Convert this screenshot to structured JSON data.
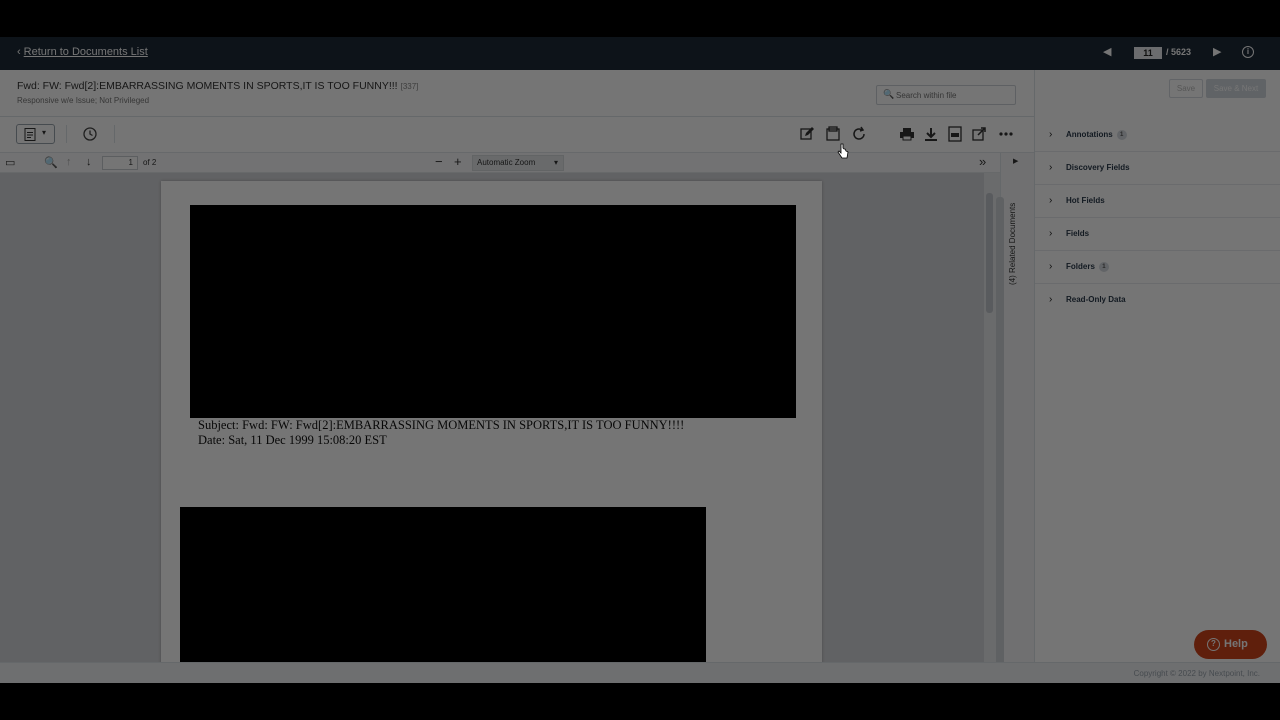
{
  "nav": {
    "back_label": "Return to Documents List",
    "current_page": "11",
    "total_pages": "/ 5623"
  },
  "doc": {
    "title": "Fwd: FW: Fwd[2]:EMBARRASSING MOMENTS IN SPORTS,IT IS TOO FUNNY!!!",
    "id": "[337]",
    "subtitle": "Responsive w/e Issue; Not Privileged"
  },
  "search": {
    "placeholder": "Search within file"
  },
  "actions": {
    "save_label": "Save",
    "save_next_label": "Save & Next"
  },
  "panels": [
    {
      "label": "Annotations",
      "badge": "1"
    },
    {
      "label": "Discovery Fields",
      "badge": ""
    },
    {
      "label": "Hot Fields",
      "badge": ""
    },
    {
      "label": "Fields",
      "badge": ""
    },
    {
      "label": "Folders",
      "badge": "1"
    },
    {
      "label": "Read-Only Data",
      "badge": ""
    }
  ],
  "viewer": {
    "page": "1",
    "page_of": "of 2",
    "zoom": "Automatic Zoom"
  },
  "content": {
    "subject_line": "Subject: Fwd: FW: Fwd[2]:EMBARRASSING MOMENTS IN SPORTS,IT IS TOO FUNNY!!!!",
    "date_line": "Date: Sat, 11 Dec 1999 15:08:20 EST"
  },
  "sidebar_tab": {
    "related_label": "(4) Related Documents"
  },
  "footer": {
    "copyright": "Copyright © 2022 by Nextpoint, Inc."
  },
  "help": {
    "label": "Help"
  },
  "colors": {
    "nav_bg": "#1d2a38",
    "help_bg": "#d0451b",
    "accent": "#2a3a4a"
  }
}
